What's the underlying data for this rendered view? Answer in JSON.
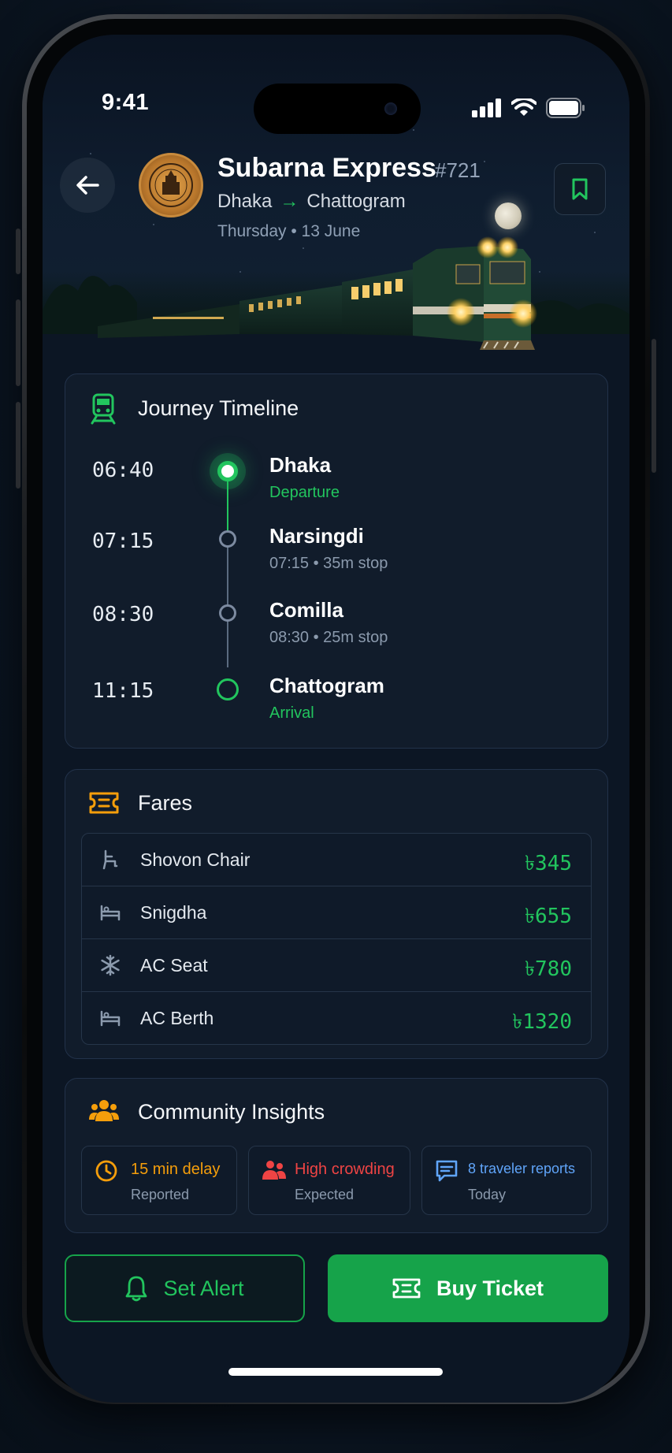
{
  "status_bar": {
    "time": "9:41"
  },
  "header": {
    "train_name": "Subarna Express",
    "train_number": "#721",
    "origin": "Dhaka",
    "destination": "Chattogram",
    "route_arrow": "→",
    "date": "Thursday • 13 June",
    "back_icon": "arrow-left-icon",
    "bookmark_icon": "bookmark-icon",
    "emblem": "bangladesh-railway-emblem"
  },
  "timeline": {
    "title": "Journey Timeline",
    "icon": "train-icon",
    "stops": [
      {
        "time": "06:40",
        "station": "Dhaka",
        "detail": "Departure"
      },
      {
        "time": "07:15",
        "station": "Narsingdi",
        "detail": "07:15 • 35m stop"
      },
      {
        "time": "08:30",
        "station": "Comilla",
        "detail": "08:30 • 25m stop"
      },
      {
        "time": "11:15",
        "station": "Chattogram",
        "detail": "Arrival"
      }
    ]
  },
  "fares": {
    "title": "Fares",
    "icon": "ticket-icon",
    "rows": [
      {
        "icon": "seat-icon",
        "name": "Shovon Chair",
        "price": "৳345"
      },
      {
        "icon": "bed-icon",
        "name": "Snigdha",
        "price": "৳655"
      },
      {
        "icon": "snowflake-icon",
        "name": "AC Seat",
        "price": "৳780"
      },
      {
        "icon": "bed-icon",
        "name": "AC Berth",
        "price": "৳1320"
      }
    ]
  },
  "insights": {
    "title": "Community Insights",
    "icon": "users-icon",
    "items": [
      {
        "icon": "clock-icon",
        "main": "15 min delay",
        "sub": "Reported",
        "color": "#f59e0b"
      },
      {
        "icon": "crowd-icon",
        "main": "High crowding",
        "sub": "Expected",
        "color": "#ef4444"
      },
      {
        "icon": "chat-icon",
        "main": "8 traveler reports",
        "sub": "Today",
        "color": "#60a5fa"
      }
    ]
  },
  "actions": {
    "alert_label": "Set Alert",
    "alert_icon": "bell-icon",
    "buy_label": "Buy Ticket",
    "buy_icon": "ticket-icon"
  },
  "colors": {
    "accent_green": "#22c55e",
    "button_green": "#16a34a",
    "card_bg": "#111c2b",
    "warning": "#f59e0b",
    "danger": "#ef4444",
    "info": "#60a5fa"
  }
}
